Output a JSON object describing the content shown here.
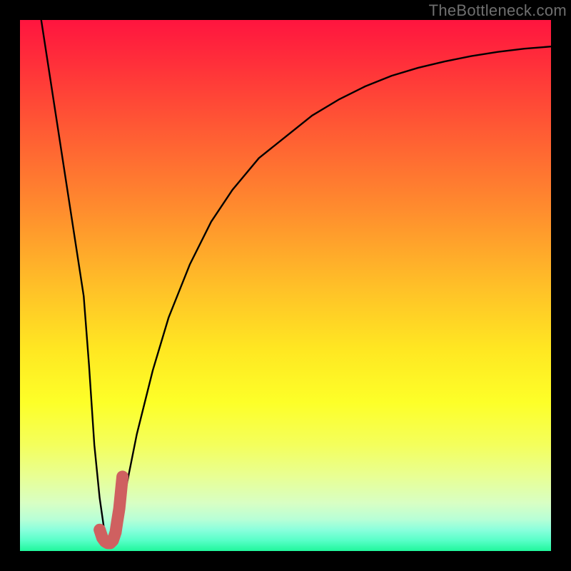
{
  "watermark": "TheBottleneck.com",
  "chart_data": {
    "type": "line",
    "title": "",
    "xlabel": "",
    "ylabel": "",
    "xlim": [
      0,
      100
    ],
    "ylim": [
      0,
      100
    ],
    "series": [
      {
        "name": "bottleneck-curve",
        "x": [
          4,
          6,
          8,
          10,
          12,
          13,
          14,
          15,
          16,
          17,
          18,
          20,
          22,
          25,
          28,
          32,
          36,
          40,
          45,
          50,
          55,
          60,
          65,
          70,
          75,
          80,
          85,
          90,
          95,
          100
        ],
        "values": [
          100,
          87,
          74,
          61,
          48,
          35,
          20,
          10,
          3,
          1,
          3,
          12,
          22,
          34,
          44,
          54,
          62,
          68,
          74,
          78,
          82,
          85,
          87.5,
          89.5,
          91,
          92.2,
          93.2,
          94,
          94.6,
          95
        ]
      }
    ],
    "highlight": {
      "name": "highlight-segment",
      "color": "#cf6060",
      "x": [
        15.0,
        15.5,
        16.0,
        16.5,
        17.0,
        17.5,
        18.0,
        18.3,
        18.7,
        19.0,
        19.3
      ],
      "values": [
        4.0,
        2.5,
        1.8,
        1.5,
        1.5,
        2.0,
        3.5,
        5.5,
        8.0,
        11.0,
        14.0
      ]
    },
    "background_gradient": {
      "stops": [
        {
          "pos": 0,
          "color": "#ff153f"
        },
        {
          "pos": 8,
          "color": "#ff2f3a"
        },
        {
          "pos": 20,
          "color": "#ff5834"
        },
        {
          "pos": 35,
          "color": "#ff8a2e"
        },
        {
          "pos": 50,
          "color": "#ffbf28"
        },
        {
          "pos": 62,
          "color": "#ffe722"
        },
        {
          "pos": 72,
          "color": "#fdff28"
        },
        {
          "pos": 80,
          "color": "#f4ff5c"
        },
        {
          "pos": 86,
          "color": "#e8ff94"
        },
        {
          "pos": 91,
          "color": "#d8ffc4"
        },
        {
          "pos": 94,
          "color": "#b8ffd6"
        },
        {
          "pos": 96,
          "color": "#8affdc"
        },
        {
          "pos": 98,
          "color": "#58ffc8"
        },
        {
          "pos": 100,
          "color": "#20f79c"
        }
      ]
    }
  }
}
